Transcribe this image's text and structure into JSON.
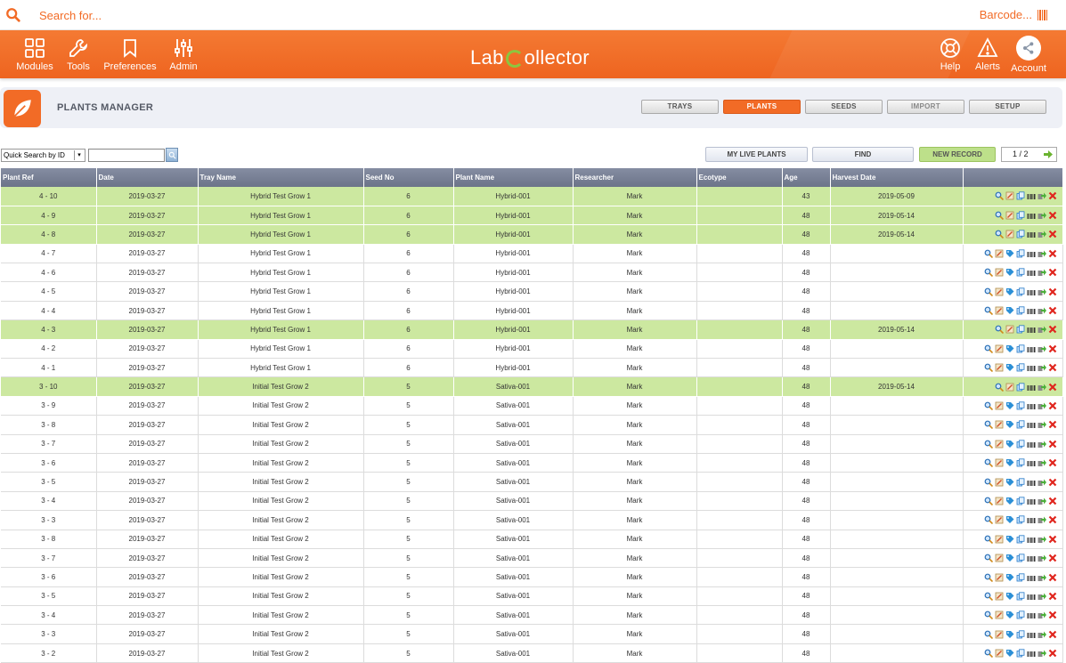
{
  "search": {
    "placeholder": "Search for...",
    "barcode": "Barcode..."
  },
  "nav": {
    "left": [
      {
        "label": "Modules",
        "icon": "modules-icon"
      },
      {
        "label": "Tools",
        "icon": "wrench-icon"
      },
      {
        "label": "Preferences",
        "icon": "bookmark-icon"
      },
      {
        "label": "Admin",
        "icon": "sliders-icon"
      }
    ],
    "logo_left": "Lab",
    "logo_right": "ollector",
    "right": [
      {
        "label": "Help",
        "icon": "lifebuoy-icon"
      },
      {
        "label": "Alerts",
        "icon": "warning-icon"
      },
      {
        "label": "Account",
        "icon": "share-icon"
      }
    ]
  },
  "module": {
    "title": "PLANTS MANAGER",
    "tabs": [
      {
        "label": "TRAYS",
        "state": "normal"
      },
      {
        "label": "PLANTS",
        "state": "active"
      },
      {
        "label": "SEEDS",
        "state": "normal"
      },
      {
        "label": "IMPORT",
        "state": "disabled"
      },
      {
        "label": "SETUP",
        "state": "normal"
      }
    ]
  },
  "toolbar": {
    "quick_search": "Quick Search by ID",
    "my_live_plants": "MY LIVE PLANTS",
    "find": "FIND",
    "new_record": "NEW RECORD",
    "pager": "1 / 2"
  },
  "table": {
    "columns": [
      "Plant Ref",
      "Date",
      "Tray Name",
      "Seed No",
      "Plant Name",
      "Researcher",
      "Ecotype",
      "Age",
      "Harvest Date",
      ""
    ],
    "rows": [
      {
        "ref": "4 - 10",
        "date": "2019-03-27",
        "tray": "Hybrid Test Grow 1",
        "seed": "6",
        "plant": "Hybrid-001",
        "researcher": "Mark",
        "ecotype": "",
        "age": "43",
        "harvest": "2019-05-09",
        "highlight": true
      },
      {
        "ref": "4 - 9",
        "date": "2019-03-27",
        "tray": "Hybrid Test Grow 1",
        "seed": "6",
        "plant": "Hybrid-001",
        "researcher": "Mark",
        "ecotype": "",
        "age": "48",
        "harvest": "2019-05-14",
        "highlight": true
      },
      {
        "ref": "4 - 8",
        "date": "2019-03-27",
        "tray": "Hybrid Test Grow 1",
        "seed": "6",
        "plant": "Hybrid-001",
        "researcher": "Mark",
        "ecotype": "",
        "age": "48",
        "harvest": "2019-05-14",
        "highlight": true
      },
      {
        "ref": "4 - 7",
        "date": "2019-03-27",
        "tray": "Hybrid Test Grow 1",
        "seed": "6",
        "plant": "Hybrid-001",
        "researcher": "Mark",
        "ecotype": "",
        "age": "48",
        "harvest": "",
        "highlight": false
      },
      {
        "ref": "4 - 6",
        "date": "2019-03-27",
        "tray": "Hybrid Test Grow 1",
        "seed": "6",
        "plant": "Hybrid-001",
        "researcher": "Mark",
        "ecotype": "",
        "age": "48",
        "harvest": "",
        "highlight": false
      },
      {
        "ref": "4 - 5",
        "date": "2019-03-27",
        "tray": "Hybrid Test Grow 1",
        "seed": "6",
        "plant": "Hybrid-001",
        "researcher": "Mark",
        "ecotype": "",
        "age": "48",
        "harvest": "",
        "highlight": false
      },
      {
        "ref": "4 - 4",
        "date": "2019-03-27",
        "tray": "Hybrid Test Grow 1",
        "seed": "6",
        "plant": "Hybrid-001",
        "researcher": "Mark",
        "ecotype": "",
        "age": "48",
        "harvest": "",
        "highlight": false
      },
      {
        "ref": "4 - 3",
        "date": "2019-03-27",
        "tray": "Hybrid Test Grow 1",
        "seed": "6",
        "plant": "Hybrid-001",
        "researcher": "Mark",
        "ecotype": "",
        "age": "48",
        "harvest": "2019-05-14",
        "highlight": true
      },
      {
        "ref": "4 - 2",
        "date": "2019-03-27",
        "tray": "Hybrid Test Grow 1",
        "seed": "6",
        "plant": "Hybrid-001",
        "researcher": "Mark",
        "ecotype": "",
        "age": "48",
        "harvest": "",
        "highlight": false
      },
      {
        "ref": "4 - 1",
        "date": "2019-03-27",
        "tray": "Hybrid Test Grow 1",
        "seed": "6",
        "plant": "Hybrid-001",
        "researcher": "Mark",
        "ecotype": "",
        "age": "48",
        "harvest": "",
        "highlight": false
      },
      {
        "ref": "3 - 10",
        "date": "2019-03-27",
        "tray": "Initial Test Grow 2",
        "seed": "5",
        "plant": "Sativa-001",
        "researcher": "Mark",
        "ecotype": "",
        "age": "48",
        "harvest": "2019-05-14",
        "highlight": true
      },
      {
        "ref": "3 - 9",
        "date": "2019-03-27",
        "tray": "Initial Test Grow 2",
        "seed": "5",
        "plant": "Sativa-001",
        "researcher": "Mark",
        "ecotype": "",
        "age": "48",
        "harvest": "",
        "highlight": false
      },
      {
        "ref": "3 - 8",
        "date": "2019-03-27",
        "tray": "Initial Test Grow 2",
        "seed": "5",
        "plant": "Sativa-001",
        "researcher": "Mark",
        "ecotype": "",
        "age": "48",
        "harvest": "",
        "highlight": false
      },
      {
        "ref": "3 - 7",
        "date": "2019-03-27",
        "tray": "Initial Test Grow 2",
        "seed": "5",
        "plant": "Sativa-001",
        "researcher": "Mark",
        "ecotype": "",
        "age": "48",
        "harvest": "",
        "highlight": false
      },
      {
        "ref": "3 - 6",
        "date": "2019-03-27",
        "tray": "Initial Test Grow 2",
        "seed": "5",
        "plant": "Sativa-001",
        "researcher": "Mark",
        "ecotype": "",
        "age": "48",
        "harvest": "",
        "highlight": false
      },
      {
        "ref": "3 - 5",
        "date": "2019-03-27",
        "tray": "Initial Test Grow 2",
        "seed": "5",
        "plant": "Sativa-001",
        "researcher": "Mark",
        "ecotype": "",
        "age": "48",
        "harvest": "",
        "highlight": false
      },
      {
        "ref": "3 - 4",
        "date": "2019-03-27",
        "tray": "Initial Test Grow 2",
        "seed": "5",
        "plant": "Sativa-001",
        "researcher": "Mark",
        "ecotype": "",
        "age": "48",
        "harvest": "",
        "highlight": false
      },
      {
        "ref": "3 - 3",
        "date": "2019-03-27",
        "tray": "Initial Test Grow 2",
        "seed": "5",
        "plant": "Sativa-001",
        "researcher": "Mark",
        "ecotype": "",
        "age": "48",
        "harvest": "",
        "highlight": false
      },
      {
        "ref": "3 - 8",
        "date": "2019-03-27",
        "tray": "Initial Test Grow 2",
        "seed": "5",
        "plant": "Sativa-001",
        "researcher": "Mark",
        "ecotype": "",
        "age": "48",
        "harvest": "",
        "highlight": false
      },
      {
        "ref": "3 - 7",
        "date": "2019-03-27",
        "tray": "Initial Test Grow 2",
        "seed": "5",
        "plant": "Sativa-001",
        "researcher": "Mark",
        "ecotype": "",
        "age": "48",
        "harvest": "",
        "highlight": false
      },
      {
        "ref": "3 - 6",
        "date": "2019-03-27",
        "tray": "Initial Test Grow 2",
        "seed": "5",
        "plant": "Sativa-001",
        "researcher": "Mark",
        "ecotype": "",
        "age": "48",
        "harvest": "",
        "highlight": false
      },
      {
        "ref": "3 - 5",
        "date": "2019-03-27",
        "tray": "Initial Test Grow 2",
        "seed": "5",
        "plant": "Sativa-001",
        "researcher": "Mark",
        "ecotype": "",
        "age": "48",
        "harvest": "",
        "highlight": false
      },
      {
        "ref": "3 - 4",
        "date": "2019-03-27",
        "tray": "Initial Test Grow 2",
        "seed": "5",
        "plant": "Sativa-001",
        "researcher": "Mark",
        "ecotype": "",
        "age": "48",
        "harvest": "",
        "highlight": false
      },
      {
        "ref": "3 - 3",
        "date": "2019-03-27",
        "tray": "Initial Test Grow 2",
        "seed": "5",
        "plant": "Sativa-001",
        "researcher": "Mark",
        "ecotype": "",
        "age": "48",
        "harvest": "",
        "highlight": false
      },
      {
        "ref": "3 - 2",
        "date": "2019-03-27",
        "tray": "Initial Test Grow 2",
        "seed": "5",
        "plant": "Sativa-001",
        "researcher": "Mark",
        "ecotype": "",
        "age": "48",
        "harvest": "",
        "highlight": false
      }
    ],
    "row_actions_full": [
      "view-icon",
      "edit-icon",
      "tag-icon",
      "copy-icon",
      "barcode-icon",
      "move-icon",
      "delete-icon"
    ],
    "row_actions_harvested": [
      "view-icon",
      "edit-icon",
      "copy-icon",
      "barcode-icon",
      "move-icon",
      "delete-icon"
    ]
  },
  "colors": {
    "brand": "#f26b26",
    "highlight_row": "#cce8a0",
    "header": "#7a8297",
    "accent_green": "#8cc63f"
  }
}
